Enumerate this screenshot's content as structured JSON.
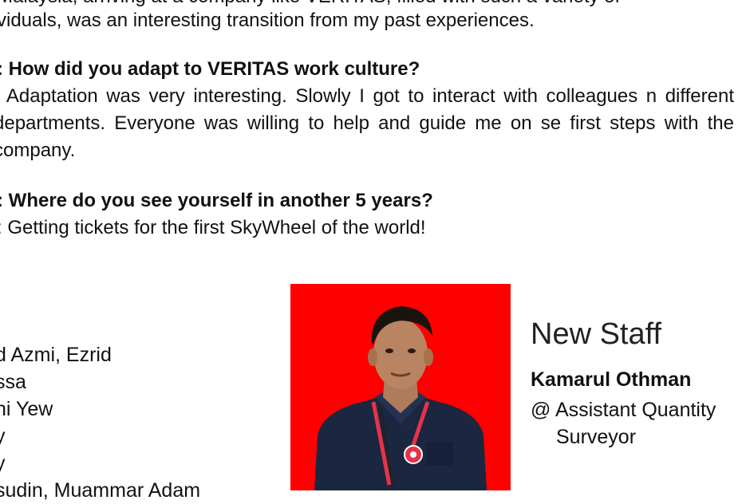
{
  "article": {
    "partial_top_line": "Malaysia, arriving at a company like VERITAS, filled with such a variety of",
    "intro_line": "viduals, was an interesting transition from my past experiences.",
    "qa": [
      {
        "question": ": How did you adapt to VERITAS work culture?",
        "answer": ": Adaptation was very interesting. Slowly I got to interact with colleagues n different departments. Everyone was willing to help and guide me on se first steps with the company."
      },
      {
        "question": ": Where do you see yourself in another 5 years?",
        "answer": ": Getting tickets for the first SkyWheel of the world!"
      }
    ]
  },
  "names_list": [
    "d Azmi, Ezrid",
    "ssa",
    "ni Yew",
    "y",
    "y",
    "sudin, Muammar Adam"
  ],
  "new_staff": {
    "heading": "New Staff",
    "name": "Kamarul Othman",
    "role_line1": "@ Assistant Quantity",
    "role_line2": "Surveyor"
  },
  "colors": {
    "photo_background": "#ff0000",
    "text": "#111111"
  }
}
